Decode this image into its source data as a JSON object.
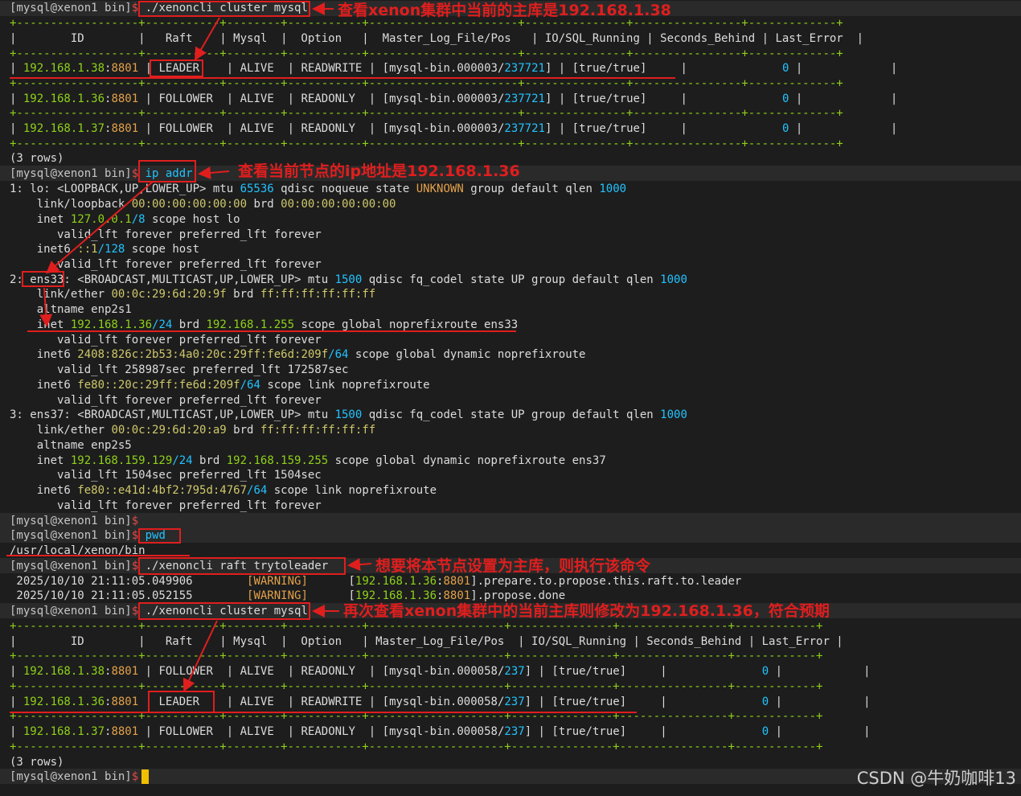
{
  "prompt": {
    "user": "[mysql@xenon1 bin]",
    "dollar": "$"
  },
  "cmd1": "./xenoncli cluster mysql",
  "table1": {
    "sep": "+------------------+-----------+--------+-----------+----------------------+---------------+----------------+-------------+",
    "header": "|        ID        |   Raft    | Mysql  |  Option   |  Master_Log_File/Pos   | IO/SQL_Running | Seconds_Behind | Last_Error  |",
    "rows": [
      {
        "ip": "192.168.1.38",
        "port": "8801",
        "raft": "LEADER",
        "mysql": "ALIVE",
        "option": "READWRITE",
        "file": "mysql-bin.000003",
        "pos": "237721",
        "io": "true/true",
        "sec": "0"
      },
      {
        "ip": "192.168.1.36",
        "port": "8801",
        "raft": "FOLLOWER",
        "mysql": "ALIVE",
        "option": "READONLY",
        "file": "mysql-bin.000003",
        "pos": "237721",
        "io": "true/true",
        "sec": "0"
      },
      {
        "ip": "192.168.1.37",
        "port": "8801",
        "raft": "FOLLOWER",
        "mysql": "ALIVE",
        "option": "READONLY",
        "file": "mysql-bin.000003",
        "pos": "237721",
        "io": "true/true",
        "sec": "0"
      }
    ],
    "rows_count": "(3 rows)"
  },
  "cmd2": "ip addr",
  "ipaddr": {
    "l1a": "1: lo: <LOOPBACK,UP,LOWER_UP> mtu ",
    "l1_mtu": "65536",
    "l1b": " qdisc noqueue state ",
    "l1_state": "UNKNOWN",
    "l1c": " group default qlen ",
    "l1_qlen": "1000",
    "l2a": "    link/loopback ",
    "l2_mac": "00:00:00:00:00:00",
    "l2b": " brd ",
    "l2_brd": "00:00:00:00:00:00",
    "l3a": "    inet ",
    "l3_ip": "127.0.0.1",
    "l3_mask": "/8",
    "l3b": " scope host lo",
    "l4": "       valid_lft forever preferred_lft forever",
    "l5a": "    inet6 ",
    "l5_ip": "::1",
    "l5_mask": "/128",
    "l5b": " scope host",
    "l6": "       valid_lft forever preferred_lft forever",
    "l7a": "2: ens33: <BROADCAST,MULTICAST,UP,LOWER_UP> mtu ",
    "l7_mtu": "1500",
    "l7b": " qdisc fq_codel state UP group default qlen ",
    "l7_qlen": "1000",
    "l8a": "    link/ether ",
    "l8_mac": "00:0c:29:6d:20:9f",
    "l8b": " brd ",
    "l8_brd": "ff:ff:ff:ff:ff:ff",
    "l9": "    altname enp2s1",
    "l10a": "    inet ",
    "l10_ip": "192.168.1.36",
    "l10_mask": "/24",
    "l10b": " brd ",
    "l10_brd": "192.168.1.255",
    "l10c": " scope global noprefixroute ens33",
    "l11": "       valid_lft forever preferred_lft forever",
    "l12a": "    inet6 ",
    "l12_ip": "2408:826c:2b53:4a0:20c:29ff:fe6d:209f",
    "l12_mask": "/64",
    "l12b": " scope global dynamic noprefixroute",
    "l13": "       valid_lft 258987sec preferred_lft 172587sec",
    "l14a": "    inet6 ",
    "l14_ip": "fe80::20c:29ff:fe6d:209f",
    "l14_mask": "/64",
    "l14b": " scope link noprefixroute",
    "l15": "       valid_lft forever preferred_lft forever",
    "l16a": "3: ens37: <BROADCAST,MULTICAST,UP,LOWER_UP> mtu ",
    "l16_mtu": "1500",
    "l16b": " qdisc fq_codel state UP group default qlen ",
    "l16_qlen": "1000",
    "l17a": "    link/ether ",
    "l17_mac": "00:0c:29:6d:20:a9",
    "l17b": " brd ",
    "l17_brd": "ff:ff:ff:ff:ff:ff",
    "l18": "    altname enp2s5",
    "l19a": "    inet ",
    "l19_ip": "192.168.159.129",
    "l19_mask": "/24",
    "l19b": " brd ",
    "l19_brd": "192.168.159.255",
    "l19c": " scope global dynamic noprefixroute ens37",
    "l20": "       valid_lft 1504sec preferred_lft 1504sec",
    "l21a": "    inet6 ",
    "l21_ip": "fe80::e41d:4bf2:795d:4767",
    "l21_mask": "/64",
    "l21b": " scope link noprefixroute",
    "l22": "       valid_lft forever preferred_lft forever"
  },
  "cmd3": "pwd",
  "pwd_out": "/usr/local/xenon/bin",
  "cmd4": "./xenoncli raft trytoleader",
  "log": [
    {
      "ts": " 2025/10/10 21:11:05.049906",
      "level": "[WARNING]",
      "ip": "192.168.1.36",
      "port": "8801",
      "msg": "].prepare.to.propose.this.raft.to.leader"
    },
    {
      "ts": " 2025/10/10 21:11:05.052155",
      "level": "[WARNING]",
      "ip": "192.168.1.36",
      "port": "8801",
      "msg": "].propose.done"
    }
  ],
  "cmd5": "./xenoncli cluster mysql",
  "table2": {
    "sep": "+------------------+-----------+--------+-----------+--------------------+---------------+----------------+------------+",
    "header": "|        ID        |   Raft    | Mysql  |  Option   | Master_Log_File/Pos  | IO/SQL_Running | Seconds_Behind | Last_Error |",
    "rows": [
      {
        "ip": "192.168.1.38",
        "port": "8801",
        "raft": "FOLLOWER",
        "mysql": "ALIVE",
        "option": "READONLY",
        "file": "mysql-bin.000058",
        "pos": "237",
        "io": "true/true",
        "sec": "0"
      },
      {
        "ip": "192.168.1.36",
        "port": "8801",
        "raft": "LEADER",
        "mysql": "ALIVE",
        "option": "READWRITE",
        "file": "mysql-bin.000058",
        "pos": "237",
        "io": "true/true",
        "sec": "0"
      },
      {
        "ip": "192.168.1.37",
        "port": "8801",
        "raft": "FOLLOWER",
        "mysql": "ALIVE",
        "option": "READONLY",
        "file": "mysql-bin.000058",
        "pos": "237",
        "io": "true/true",
        "sec": "0"
      }
    ],
    "rows_count": "(3 rows)"
  },
  "annotations": {
    "a1": "查看xenon集群中当前的主库是192.168.1.38",
    "a2": "查看当前节点的ip地址是192.168.1.36",
    "a3": "想要将本节点设置为主库，则执行该命令",
    "a4": "再次查看xenon集群中的当前主库则修改为192.168.1.36，符合预期"
  },
  "watermark": "CSDN @牛奶咖啡13",
  "colors": {
    "background": "#1d1d1d",
    "annotation": "#e01e1e",
    "green": "#8fd11a",
    "cyan": "#22c3ff"
  }
}
